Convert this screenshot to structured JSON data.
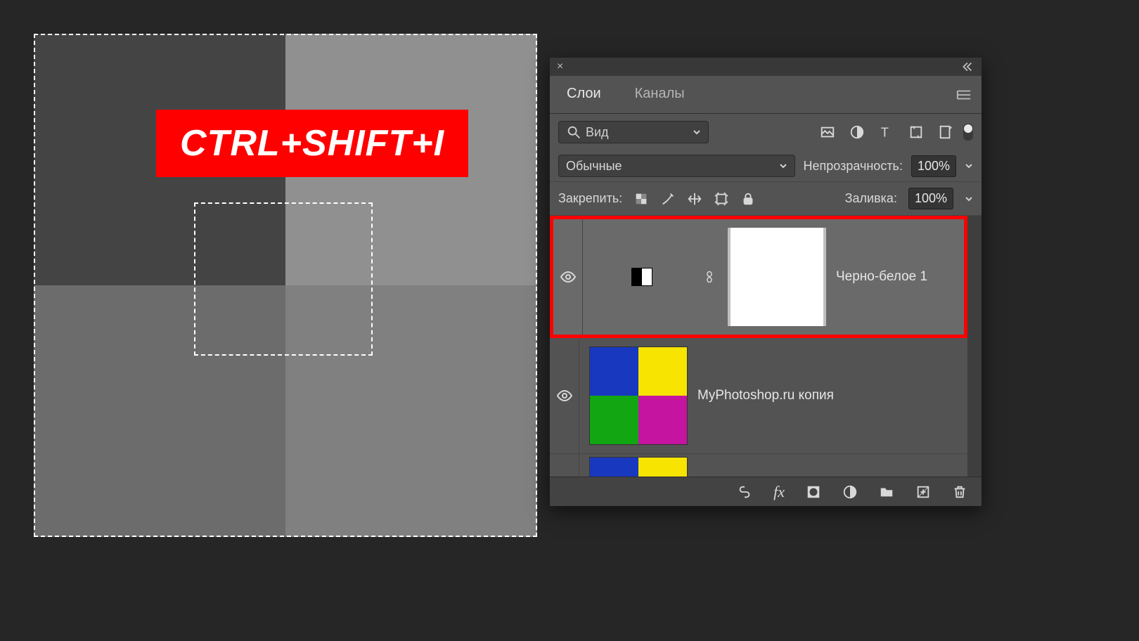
{
  "hotkey_label": "CTRL+SHIFT+I",
  "panel": {
    "tabs": {
      "layers": "Слои",
      "channels": "Каналы"
    },
    "kind_select": "Вид",
    "blend_mode": "Обычные",
    "opacity_label": "Непрозрачность:",
    "opacity_value": "100%",
    "lock_label": "Закрепить:",
    "fill_label": "Заливка:",
    "fill_value": "100%"
  },
  "layers": {
    "bw": "Черно-белое 1",
    "main": "MyPhotoshop.ru копия"
  }
}
